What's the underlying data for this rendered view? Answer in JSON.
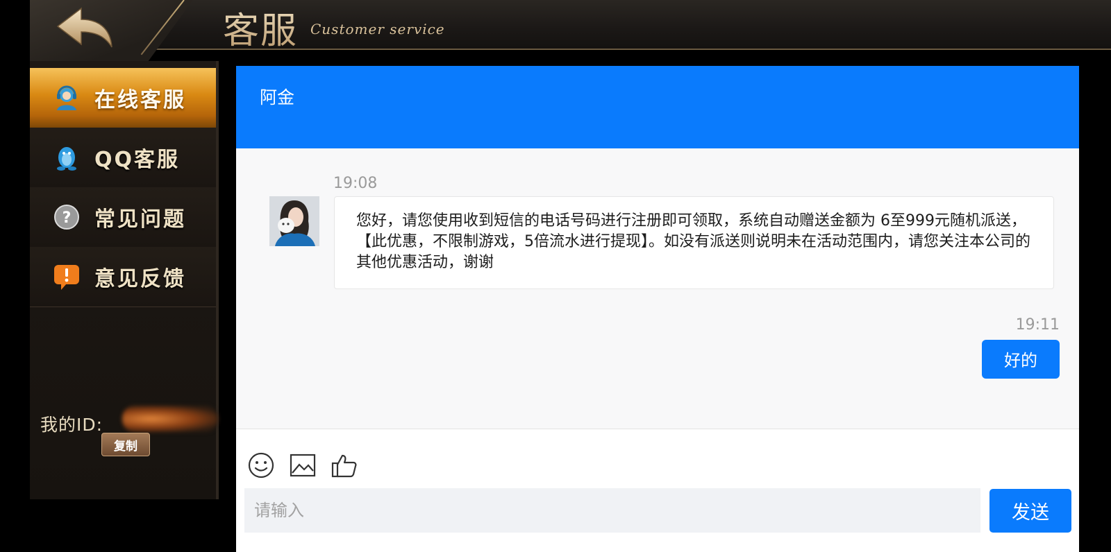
{
  "header": {
    "title_cn": "客服",
    "title_en": "Customer service"
  },
  "sidebar": {
    "items": [
      {
        "label": "在线客服",
        "icon": "headset-agent-icon",
        "active": true
      },
      {
        "label": "QQ客服",
        "icon": "qq-penguin-icon",
        "active": false
      },
      {
        "label": "常见问题",
        "icon": "question-mark-icon",
        "active": false
      },
      {
        "label": "意见反馈",
        "icon": "feedback-exclamation-icon",
        "active": false
      }
    ],
    "my_id_label": "我的ID:",
    "copy_label": "复制"
  },
  "chat": {
    "agent_name": "阿金",
    "messages": [
      {
        "side": "left",
        "time": "19:08",
        "text": "您好，请您使用收到短信的电话号码进行注册即可领取，系统自动赠送金额为 6至999元随机派送，【此优惠，不限制游戏，5倍流水进行提现】。如没有派送则说明未在活动范围内，请您关注本公司的其他优惠活动，谢谢"
      },
      {
        "side": "right",
        "time": "19:11",
        "text": "好的"
      }
    ],
    "toolbar": [
      "emoji-icon",
      "image-icon",
      "thumbs-up-icon"
    ],
    "input_placeholder": "请输入",
    "send_label": "发送"
  },
  "colors": {
    "accent_blue": "#0a7bfd",
    "sidebar_active": "#d98913"
  }
}
